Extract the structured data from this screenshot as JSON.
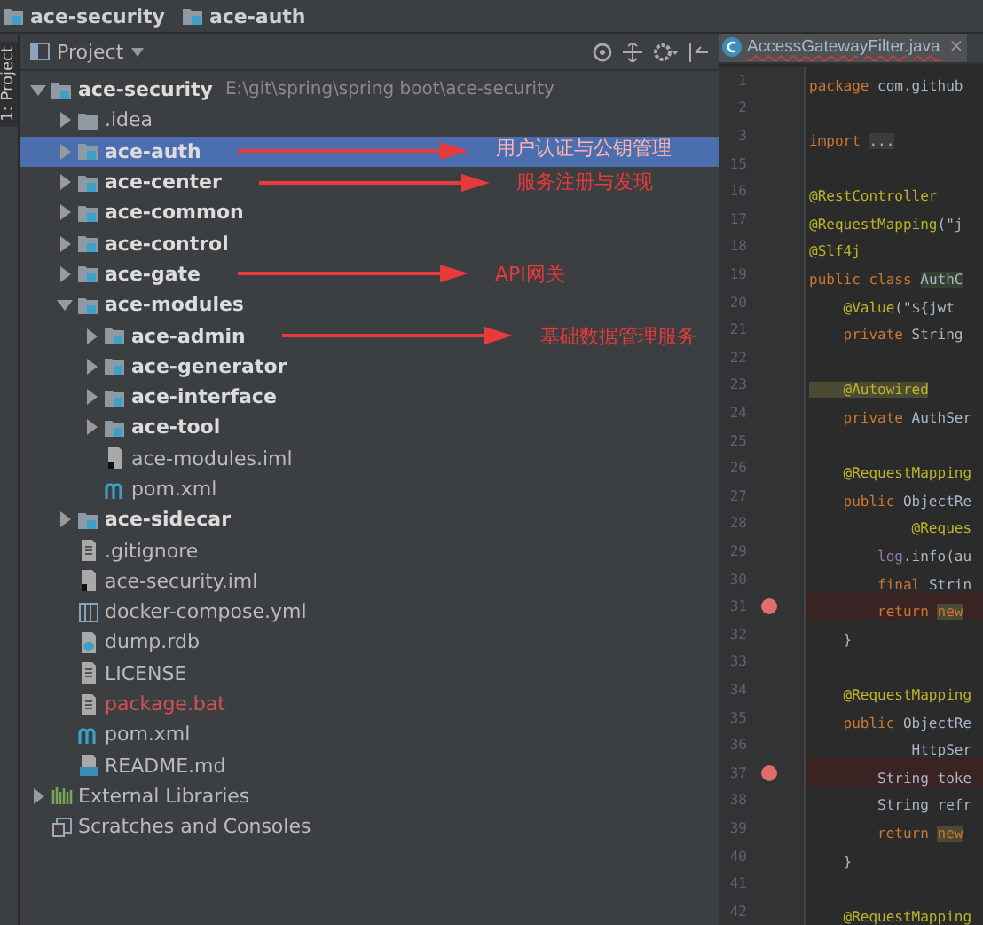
{
  "breadcrumbs": [
    "ace-security",
    "ace-auth"
  ],
  "tool_strip": {
    "label": "1: Project"
  },
  "project_panel": {
    "title": "Project",
    "tree": [
      {
        "label": "ace-security",
        "kind": "module",
        "path": "E:\\git\\spring\\spring boot\\ace-security",
        "expanded": true,
        "selected": false,
        "untracked": false,
        "children": [
          {
            "label": ".idea",
            "kind": "folder",
            "expanded": false,
            "selected": false,
            "untracked": false
          },
          {
            "label": "ace-auth",
            "kind": "module",
            "expanded": false,
            "selected": true,
            "untracked": false,
            "note": "用户认证与公钥管理"
          },
          {
            "label": "ace-center",
            "kind": "module",
            "expanded": false,
            "selected": false,
            "untracked": false,
            "note": "服务注册与发现"
          },
          {
            "label": "ace-common",
            "kind": "module",
            "expanded": false,
            "selected": false,
            "untracked": false
          },
          {
            "label": "ace-control",
            "kind": "module",
            "expanded": false,
            "selected": false,
            "untracked": false
          },
          {
            "label": "ace-gate",
            "kind": "module",
            "expanded": false,
            "selected": false,
            "untracked": false,
            "note": "API网关"
          },
          {
            "label": "ace-modules",
            "kind": "module",
            "expanded": true,
            "selected": false,
            "untracked": false,
            "children": [
              {
                "label": "ace-admin",
                "kind": "module",
                "expanded": false,
                "selected": false,
                "untracked": false,
                "note": "基础数据管理服务"
              },
              {
                "label": "ace-generator",
                "kind": "module",
                "expanded": false,
                "selected": false,
                "untracked": false
              },
              {
                "label": "ace-interface",
                "kind": "module",
                "expanded": false,
                "selected": false,
                "untracked": false
              },
              {
                "label": "ace-tool",
                "kind": "module",
                "expanded": false,
                "selected": false,
                "untracked": false
              },
              {
                "label": "ace-modules.iml",
                "kind": "iml",
                "selected": false,
                "untracked": false
              },
              {
                "label": "pom.xml",
                "kind": "pom",
                "selected": false,
                "untracked": false
              }
            ]
          },
          {
            "label": "ace-sidecar",
            "kind": "module",
            "expanded": false,
            "selected": false,
            "untracked": false
          },
          {
            "label": ".gitignore",
            "kind": "text",
            "selected": false,
            "untracked": false
          },
          {
            "label": "ace-security.iml",
            "kind": "iml",
            "selected": false,
            "untracked": false
          },
          {
            "label": "docker-compose.yml",
            "kind": "yml",
            "selected": false,
            "untracked": false
          },
          {
            "label": "dump.rdb",
            "kind": "rdb",
            "selected": false,
            "untracked": false
          },
          {
            "label": "LICENSE",
            "kind": "text",
            "selected": false,
            "untracked": false
          },
          {
            "label": "package.bat",
            "kind": "text",
            "selected": false,
            "untracked": true
          },
          {
            "label": "pom.xml",
            "kind": "pom",
            "selected": false,
            "untracked": false
          },
          {
            "label": "README.md",
            "kind": "md",
            "selected": false,
            "untracked": false
          }
        ]
      },
      {
        "label": "External Libraries",
        "kind": "libraries",
        "expanded": false,
        "selected": false,
        "untracked": false
      },
      {
        "label": "Scratches and Consoles",
        "kind": "scratches",
        "selected": false,
        "untracked": false
      }
    ]
  },
  "editor": {
    "tab": {
      "label": "AccessGatewayFilter.java",
      "close": "×",
      "selected": true
    },
    "lines": [
      {
        "n": "1",
        "breakpoint": false,
        "code": [
          {
            "t": "package ",
            "kind": "keyword"
          },
          {
            "t": "com.github",
            "kind": "plain"
          }
        ]
      },
      {
        "n": "2",
        "breakpoint": false
      },
      {
        "n": "3",
        "breakpoint": false,
        "code": [
          {
            "t": "import ",
            "kind": "keyword"
          },
          {
            "t": "...",
            "kind": "folded"
          }
        ]
      },
      {
        "n": "15",
        "breakpoint": false
      },
      {
        "n": "16",
        "breakpoint": false,
        "code": [
          {
            "t": "@RestController",
            "kind": "annotation"
          }
        ]
      },
      {
        "n": "17",
        "breakpoint": false,
        "code": [
          {
            "t": "@RequestMapping",
            "kind": "annotation"
          },
          {
            "t": "(\"j",
            "kind": "plain"
          }
        ]
      },
      {
        "n": "18",
        "breakpoint": false,
        "code": [
          {
            "t": "@Slf4j",
            "kind": "annotation"
          }
        ]
      },
      {
        "n": "19",
        "breakpoint": false,
        "code": [
          {
            "t": "public class ",
            "kind": "keyword"
          },
          {
            "t": "AuthC",
            "kind": "marked"
          }
        ]
      },
      {
        "n": "20",
        "breakpoint": false,
        "code": [
          {
            "t": "    @Value",
            "kind": "annotation"
          },
          {
            "t": "(\"${jwt",
            "kind": "plain"
          }
        ]
      },
      {
        "n": "21",
        "breakpoint": false,
        "code": [
          {
            "t": "    private ",
            "kind": "keyword"
          },
          {
            "t": "String",
            "kind": "plain"
          }
        ]
      },
      {
        "n": "22",
        "breakpoint": false
      },
      {
        "n": "23",
        "breakpoint": false,
        "code": [
          {
            "t": "    @Autowired",
            "kind": "marked_annotation"
          }
        ]
      },
      {
        "n": "24",
        "breakpoint": false,
        "code": [
          {
            "t": "    private ",
            "kind": "keyword"
          },
          {
            "t": "AuthSer",
            "kind": "plain"
          }
        ]
      },
      {
        "n": "25",
        "breakpoint": false
      },
      {
        "n": "26",
        "breakpoint": false,
        "code": [
          {
            "t": "    @RequestMapping",
            "kind": "annotation"
          }
        ]
      },
      {
        "n": "27",
        "breakpoint": false,
        "code": [
          {
            "t": "    public ",
            "kind": "keyword"
          },
          {
            "t": "ObjectRe",
            "kind": "plain"
          }
        ]
      },
      {
        "n": "28",
        "breakpoint": false,
        "code": [
          {
            "t": "            @Reques",
            "kind": "annotation"
          }
        ]
      },
      {
        "n": "29",
        "breakpoint": false,
        "code": [
          {
            "t": "        log",
            "kind": "field"
          },
          {
            "t": ".info(au",
            "kind": "plain"
          }
        ]
      },
      {
        "n": "30",
        "breakpoint": false,
        "code": [
          {
            "t": "        final ",
            "kind": "keyword"
          },
          {
            "t": "Strin",
            "kind": "plain"
          }
        ]
      },
      {
        "n": "31",
        "breakpoint": true,
        "code": [
          {
            "t": "        return ",
            "kind": "keyword"
          },
          {
            "t": "new",
            "kind": "marked_keyword"
          }
        ]
      },
      {
        "n": "32",
        "breakpoint": false,
        "code": [
          {
            "t": "    }",
            "kind": "plain"
          }
        ]
      },
      {
        "n": "33",
        "breakpoint": false
      },
      {
        "n": "34",
        "breakpoint": false,
        "code": [
          {
            "t": "    @RequestMapping",
            "kind": "annotation"
          }
        ]
      },
      {
        "n": "35",
        "breakpoint": false,
        "code": [
          {
            "t": "    public ",
            "kind": "keyword"
          },
          {
            "t": "ObjectRe",
            "kind": "plain"
          }
        ]
      },
      {
        "n": "36",
        "breakpoint": false,
        "code": [
          {
            "t": "            HttpSer",
            "kind": "plain"
          }
        ]
      },
      {
        "n": "37",
        "breakpoint": true,
        "code": [
          {
            "t": "        String toke",
            "kind": "plain"
          }
        ]
      },
      {
        "n": "38",
        "breakpoint": false,
        "code": [
          {
            "t": "        String refr",
            "kind": "plain"
          }
        ]
      },
      {
        "n": "39",
        "breakpoint": false,
        "code": [
          {
            "t": "        return ",
            "kind": "keyword"
          },
          {
            "t": "new",
            "kind": "marked_keyword"
          }
        ]
      },
      {
        "n": "40",
        "breakpoint": false,
        "code": [
          {
            "t": "    }",
            "kind": "plain"
          }
        ]
      },
      {
        "n": "41",
        "breakpoint": false
      },
      {
        "n": "42",
        "breakpoint": false,
        "code": [
          {
            "t": "    @RequestMapping",
            "kind": "annotation"
          }
        ]
      }
    ]
  }
}
